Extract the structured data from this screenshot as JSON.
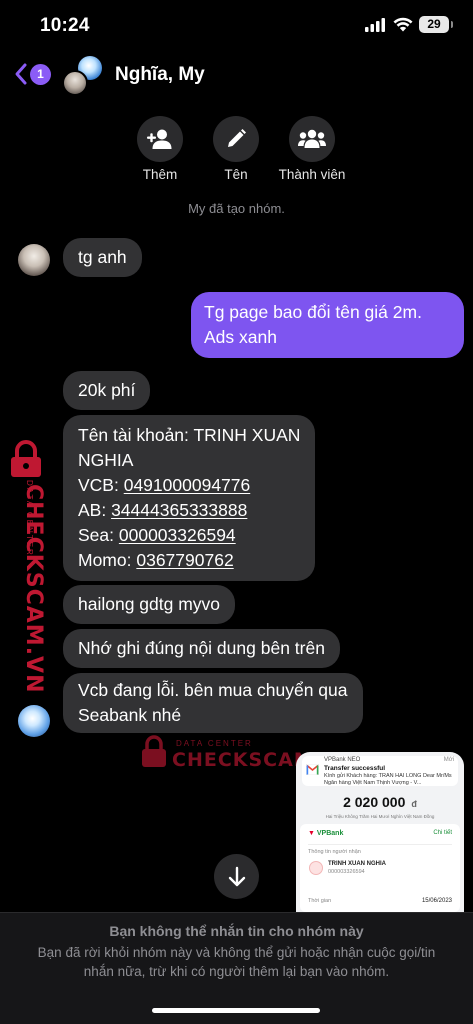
{
  "status_bar": {
    "time": "10:24",
    "battery": "29"
  },
  "header": {
    "back_badge": "1",
    "title": "Nghĩa, My"
  },
  "actions": [
    {
      "label": "Thêm",
      "icon": "add-person-icon"
    },
    {
      "label": "Tên",
      "icon": "pencil-icon"
    },
    {
      "label": "Thành viên",
      "icon": "people-icon"
    }
  ],
  "system_note": "My đã tạo nhóm.",
  "messages": {
    "m1": "tg anh",
    "m2": "Tg page bao đổi tên giá 2m. Ads xanh",
    "m3": "20k phí",
    "m4": {
      "l1": "Tên tài khoản: TRINH XUAN",
      "l2": "NGHIA",
      "vcb_label": "VCB: ",
      "vcb_num": "0491000094776",
      "ab_label": "AB: ",
      "ab_num": "34444365333888",
      "sea_label": "Sea: ",
      "sea_num": "000003326594",
      "momo_label": "Momo: ",
      "momo_num": "0367790762"
    },
    "m5": "hailong gdtg myvo",
    "m6": "Nhớ ghi đúng nội dung bên trên",
    "m7_l1": "Vcb đang lỗi. bên mua chuyển qua",
    "m7_l2": "Seabank nhé"
  },
  "watermark": {
    "small": "DATA CENTER",
    "big": "CHECKSCAM.VN"
  },
  "receipt": {
    "app": "VPBank NEO",
    "when": "Mới",
    "title": "Transfer successful",
    "body": "Kính gửi Khách hàng: TRAN HAI LONG Dear Mr/Ms Ngân hàng Việt Nam Thịnh Vượng - V...",
    "amount": "2 020 000",
    "currency": "đ",
    "amount_words": "Hai Triệu Không Trăm Hai Mươi Nghìn Việt Nam Đồng",
    "bank": "VPBank",
    "detail_link": "Chi tiết",
    "recipient_label": "Thông tin người nhận",
    "recipient_name": "TRINH XUAN NGHIA",
    "recipient_account": "000003326594",
    "time_label": "Thời gian",
    "time_value": "15/06/2023"
  },
  "footer": {
    "title": "Bạn không thể nhắn tin cho nhóm này",
    "message": "Bạn đã rời khỏi nhóm này và không thể gửi hoặc nhận cuộc gọi/tin nhắn nữa, trừ khi có người thêm lại bạn vào nhóm."
  },
  "colors": {
    "outgoing": "#7e55f0",
    "incoming": "#323234",
    "accent": "#8b5cf6",
    "watermark": "#e11d3b"
  }
}
